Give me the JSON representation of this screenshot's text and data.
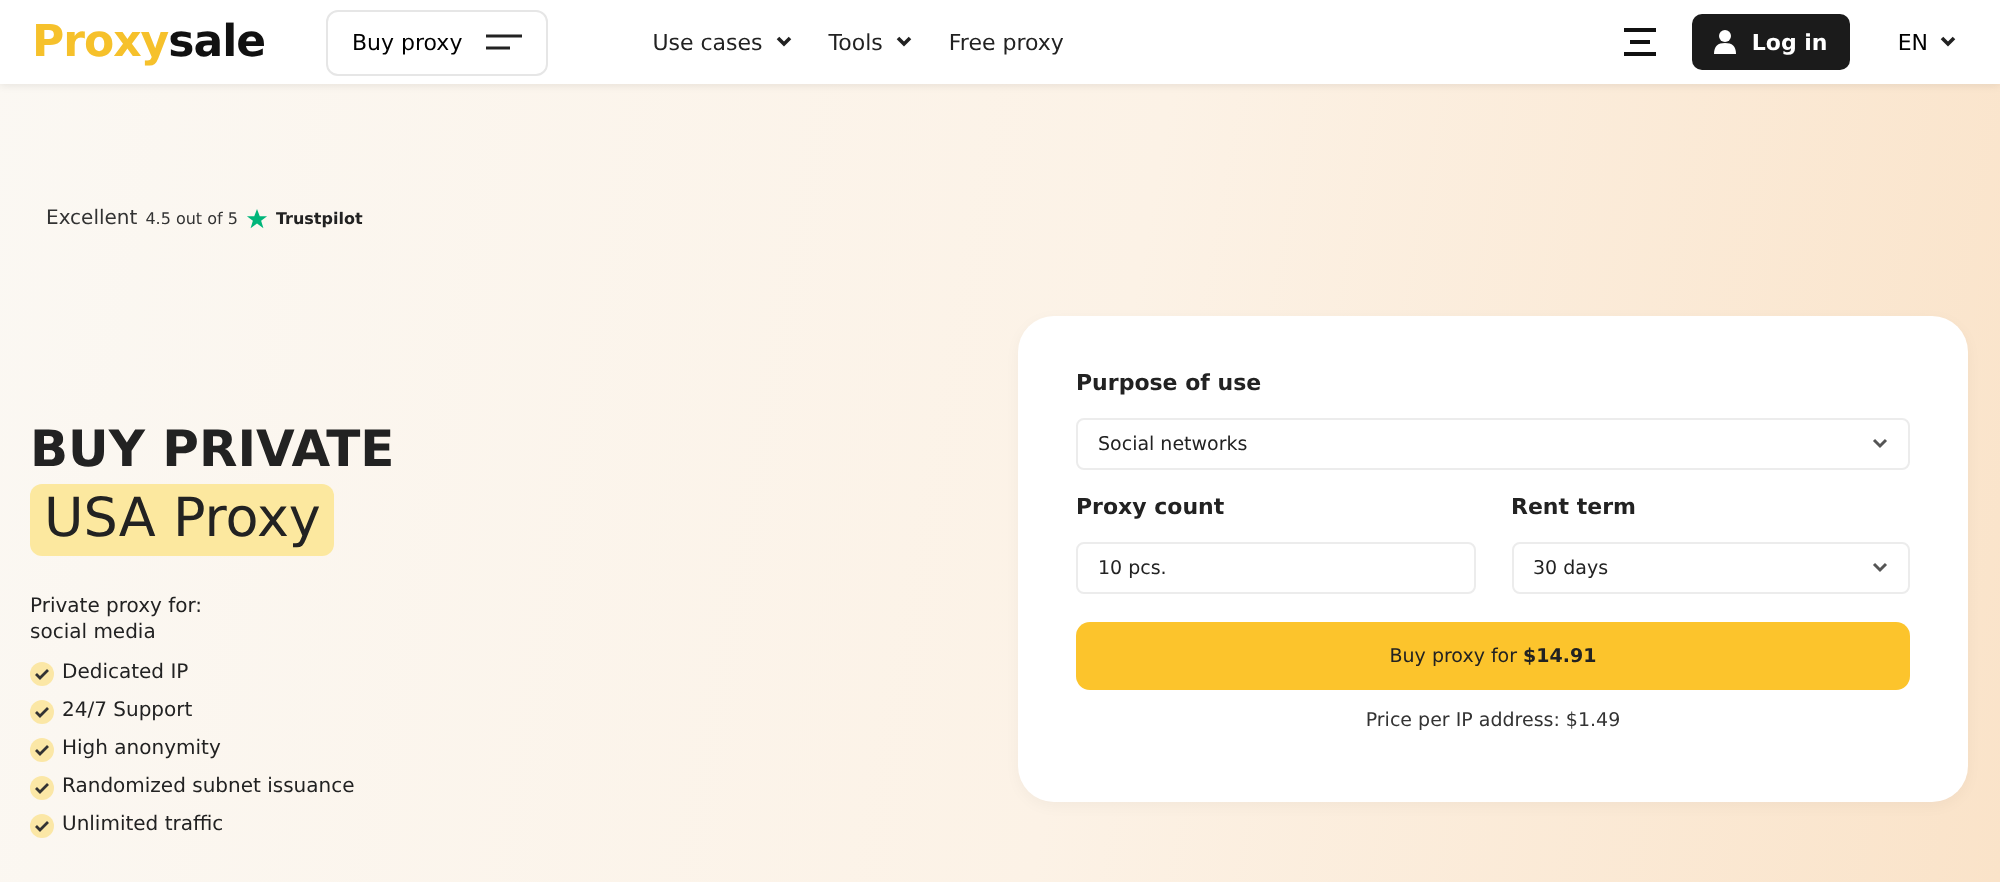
{
  "header": {
    "logo": {
      "accent": "Proxy",
      "rest": "sale"
    },
    "buy_menu": "Buy proxy",
    "nav": [
      {
        "label": "Use cases",
        "dropdown": true
      },
      {
        "label": "Tools",
        "dropdown": true
      },
      {
        "label": "Free proxy",
        "dropdown": false
      }
    ],
    "login": "Log in",
    "language": "EN"
  },
  "rating": {
    "word": "Excellent",
    "score": "4.5 out of 5",
    "brand": "Trustpilot"
  },
  "hero": {
    "title": "BUY PRIVATE",
    "highlight": "USA Proxy",
    "subtitle": "Private proxy for:",
    "purpose": "social media",
    "features": [
      "Dedicated IP",
      "24/7 Support",
      "High anonymity",
      "Randomized subnet issuance",
      "Unlimited traffic"
    ]
  },
  "form": {
    "purpose_label": "Purpose of use",
    "purpose_value": "Social networks",
    "count_label": "Proxy count",
    "count_value": "10 pcs.",
    "term_label": "Rent term",
    "term_value": "30 days",
    "buy_button": "Buy proxy for **$14.91**",
    "price_note": "Price per IP address: $1.49"
  }
}
